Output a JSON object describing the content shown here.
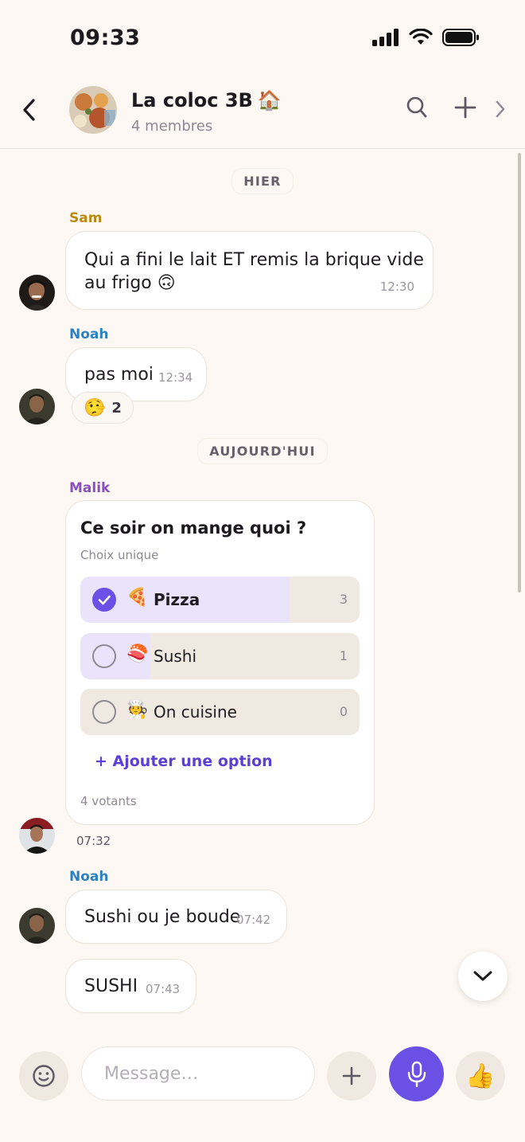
{
  "status_bar": {
    "time": "09:33"
  },
  "header": {
    "title": "La coloc 3B",
    "title_emoji": "🏠",
    "subtitle": "4 membres"
  },
  "separators": {
    "yesterday": "HIER",
    "today": "AUJOURD'HUI"
  },
  "messages": [
    {
      "sender": "Sam",
      "text_line1": "Qui a fini le lait ET remis la brique vide",
      "text_line2": "au frigo 🙃",
      "time": "12:30"
    },
    {
      "sender": "Noah",
      "text": "pas moi",
      "time": "12:34",
      "reaction_emoji": "🤥",
      "reaction_count": "2"
    },
    {
      "sender": "Noah",
      "text": "Sushi ou je boude",
      "time": "07:42"
    },
    {
      "text": "SUSHI",
      "time": "07:43"
    }
  ],
  "poll": {
    "sender": "Malik",
    "question": "Ce soir on mange quoi ?",
    "type": "Choix unique",
    "options": [
      {
        "emoji": "🍕",
        "label": "Pizza",
        "count": "3",
        "share": 0.75,
        "selected": true
      },
      {
        "emoji": "🍣",
        "label": "Sushi",
        "count": "1",
        "share": 0.25,
        "selected": false
      },
      {
        "emoji": "🧑‍🍳",
        "label": "On cuisine",
        "count": "0",
        "share": 0.0,
        "selected": false
      }
    ],
    "add_option": "+ Ajouter une option",
    "voters": "4 votants",
    "time": "07:32"
  },
  "composer": {
    "placeholder": "Message…",
    "like_emoji": "👍"
  },
  "colors": {
    "accent": "#6b50e6",
    "sam": "#b98a10",
    "noah": "#2b82c2",
    "malik": "#8a4fc0",
    "background": "#fdf8f3"
  }
}
